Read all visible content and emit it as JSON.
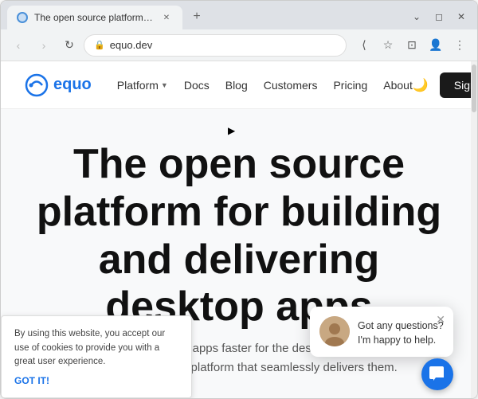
{
  "browser": {
    "tab": {
      "title": "The open source platform for b...",
      "favicon_color": "#4a90d9"
    },
    "address": {
      "url": "equo.dev",
      "secure": true
    },
    "window_controls": {
      "minimize": "–",
      "maximize": "□",
      "close": "✕"
    }
  },
  "nav": {
    "logo_text": "equo",
    "links": [
      {
        "label": "Platform",
        "dropdown": true
      },
      {
        "label": "Docs",
        "dropdown": false
      },
      {
        "label": "Blog",
        "dropdown": false
      },
      {
        "label": "Customers",
        "dropdown": false
      },
      {
        "label": "Pricing",
        "dropdown": false
      },
      {
        "label": "About",
        "dropdown": false
      }
    ],
    "dark_mode_icon": "🌙",
    "sign_button": "Sign"
  },
  "hero": {
    "title": "The open source platform for building and delivering desktop apps",
    "subtitle": "Build cross-platform apps faster for the desktop and for the web with a full-stack platform that seamlessly delivers them."
  },
  "cookie": {
    "text": "By using this website, you accept our use of cookies to provide you with a great user experience.",
    "accept_label": "GOT IT!"
  },
  "chat": {
    "message": "Got any questions? I'm happy to help.",
    "close_icon": "✕",
    "bubble_icon": "💬"
  }
}
